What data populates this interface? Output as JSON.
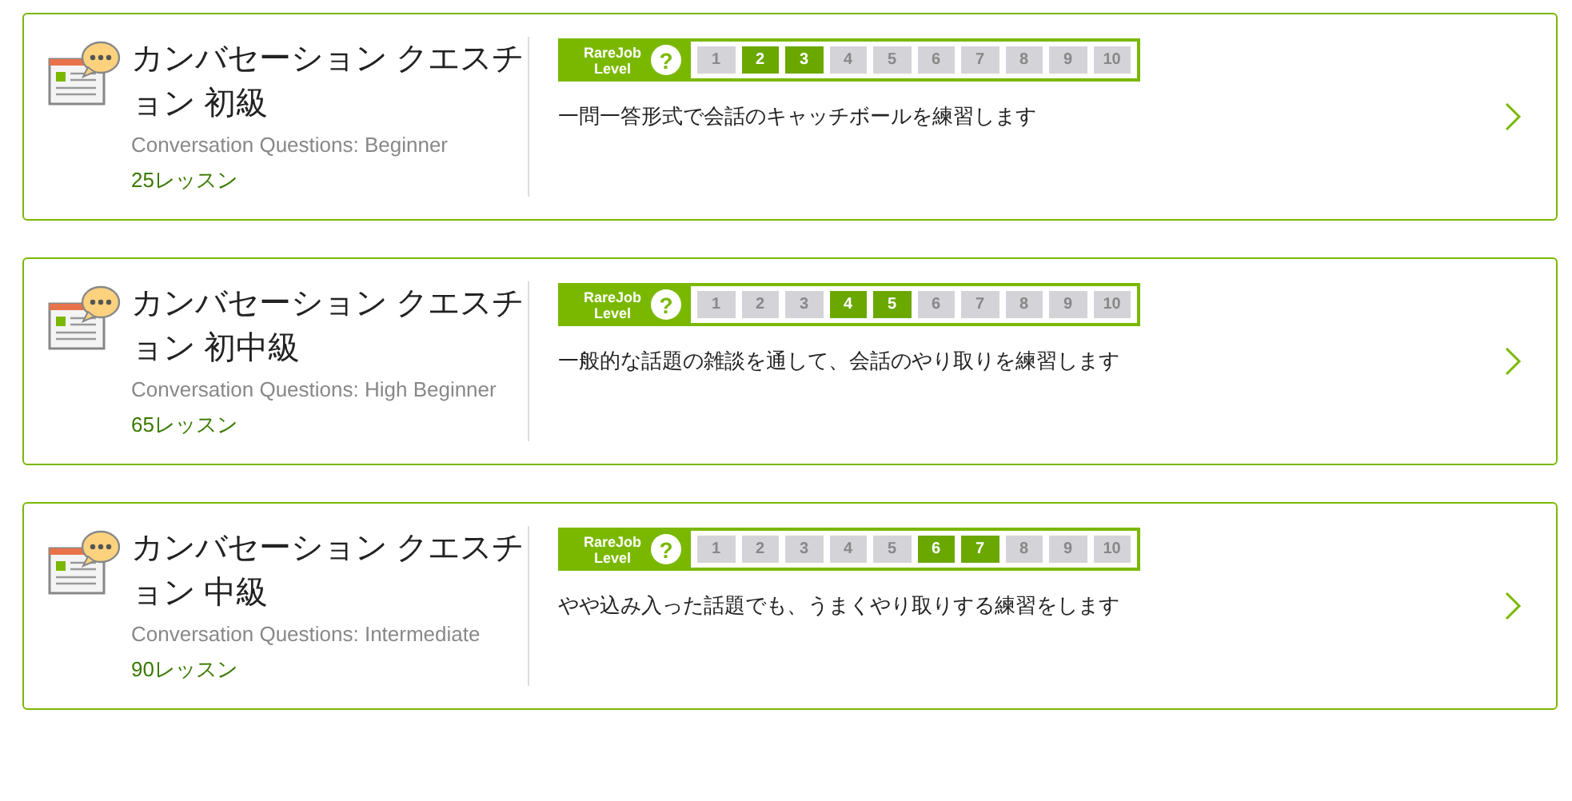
{
  "courses": [
    {
      "title": "カンバセーション クエスチョン 初級",
      "subtitle": "Conversation Questions: Beginner",
      "lessons": "25レッスン",
      "level_label": "RareJob Level",
      "help": "?",
      "levels": [
        {
          "label": "1",
          "selected": false
        },
        {
          "label": "2",
          "selected": true
        },
        {
          "label": "3",
          "selected": true
        },
        {
          "label": "4",
          "selected": false
        },
        {
          "label": "5",
          "selected": false
        },
        {
          "label": "6",
          "selected": false
        },
        {
          "label": "7",
          "selected": false
        },
        {
          "label": "8",
          "selected": false
        },
        {
          "label": "9",
          "selected": false
        },
        {
          "label": "10",
          "selected": false
        }
      ],
      "description": "一問一答形式で会話のキャッチボールを練習します"
    },
    {
      "title": "カンバセーション クエスチョン 初中級",
      "subtitle": "Conversation Questions: High Beginner",
      "lessons": "65レッスン",
      "level_label": "RareJob Level",
      "help": "?",
      "levels": [
        {
          "label": "1",
          "selected": false
        },
        {
          "label": "2",
          "selected": false
        },
        {
          "label": "3",
          "selected": false
        },
        {
          "label": "4",
          "selected": true
        },
        {
          "label": "5",
          "selected": true
        },
        {
          "label": "6",
          "selected": false
        },
        {
          "label": "7",
          "selected": false
        },
        {
          "label": "8",
          "selected": false
        },
        {
          "label": "9",
          "selected": false
        },
        {
          "label": "10",
          "selected": false
        }
      ],
      "description": "一般的な話題の雑談を通して、会話のやり取りを練習します"
    },
    {
      "title": "カンバセーション クエスチョン 中級",
      "subtitle": "Conversation Questions: Intermediate",
      "lessons": "90レッスン",
      "level_label": "RareJob Level",
      "help": "?",
      "levels": [
        {
          "label": "1",
          "selected": false
        },
        {
          "label": "2",
          "selected": false
        },
        {
          "label": "3",
          "selected": false
        },
        {
          "label": "4",
          "selected": false
        },
        {
          "label": "5",
          "selected": false
        },
        {
          "label": "6",
          "selected": true
        },
        {
          "label": "7",
          "selected": true
        },
        {
          "label": "8",
          "selected": false
        },
        {
          "label": "9",
          "selected": false
        },
        {
          "label": "10",
          "selected": false
        }
      ],
      "description": "やや込み入った話題でも、うまくやり取りする練習をします"
    }
  ]
}
